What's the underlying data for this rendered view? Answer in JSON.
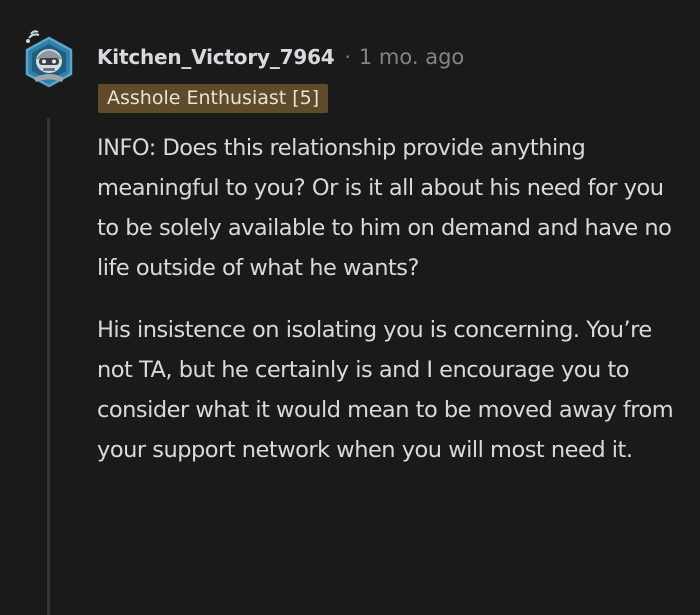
{
  "comment": {
    "author": "Kitchen_Victory_7964",
    "separator": "·",
    "timestamp": "1 mo. ago",
    "flair": "Asshole Enthusiast [5]",
    "paragraphs": [
      "INFO: Does this relationship provide anything meaningful to you? Or is it all about his need for you to be solely available to him on demand and have no life outside of what he wants?",
      "His insistence on isolating you is concerning. You’re not TA, but he certainly is and I encourage you to consider what it would mean to be moved away from your support network when you will most need it."
    ]
  },
  "colors": {
    "background": "#1a1a1b",
    "text": "#d7dadc",
    "meta": "#818384",
    "flair_bg": "#5f4b2a",
    "thread_line": "#343536",
    "avatar_accent": "#5aa6c8"
  },
  "icons": {
    "avatar": "snoo-avatar-icon"
  }
}
